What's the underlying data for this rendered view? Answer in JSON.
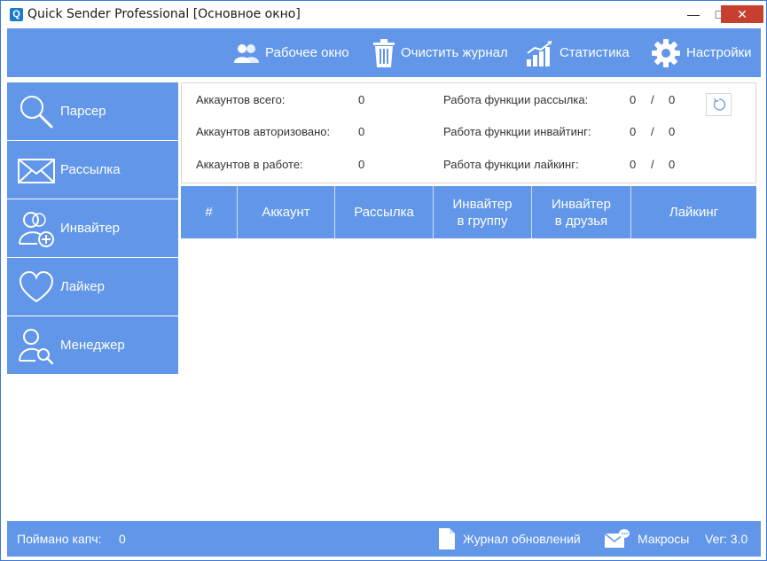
{
  "window": {
    "title": "Quick Sender Professional [Основное окно]",
    "app_icon_letter": "Q",
    "minimize_glyph": "—",
    "maximize_glyph": "□",
    "close_glyph": "✕"
  },
  "toolbar": {
    "work_window": "Рабочее окно",
    "clear_log": "Очистить журнал",
    "statistics": "Статистика",
    "settings": "Настройки"
  },
  "sidebar": {
    "items": [
      {
        "label": "Парсер",
        "icon": "search-icon"
      },
      {
        "label": "Рассылка",
        "icon": "envelope-icon"
      },
      {
        "label": "Инвайтер",
        "icon": "user-add-icon"
      },
      {
        "label": "Лайкер",
        "icon": "heart-icon"
      },
      {
        "label": "Менеджер",
        "icon": "user-search-icon"
      }
    ]
  },
  "stats": {
    "accounts_total_label": "Аккаунтов всего:",
    "accounts_total_value": "0",
    "accounts_auth_label": "Аккаунтов авторизовано:",
    "accounts_auth_value": "0",
    "accounts_working_label": "Аккаунтов в работе:",
    "accounts_working_value": "0",
    "mailing_label": "Работа функции рассылка:",
    "mailing_done": "0",
    "mailing_total": "0",
    "inviting_label": "Работа функции инвайтинг:",
    "inviting_done": "0",
    "inviting_total": "0",
    "liking_label": "Работа функции лайкинг:",
    "liking_done": "0",
    "liking_total": "0",
    "separator": "/"
  },
  "table": {
    "columns": [
      "#",
      "Аккаунт",
      "Рассылка",
      "Инвайтер\nв группу",
      "Инвайтер\nв друзья",
      "Лайкинг"
    ],
    "rows": []
  },
  "statusbar": {
    "captcha_label": "Поймано капч:",
    "captcha_value": "0",
    "update_log": "Журнал обновлений",
    "macros": "Макросы",
    "version": "Ver: 3.0"
  },
  "colors": {
    "accent": "#6196e8",
    "close_button": "#c7402f",
    "window_border": "#3a78d8"
  }
}
